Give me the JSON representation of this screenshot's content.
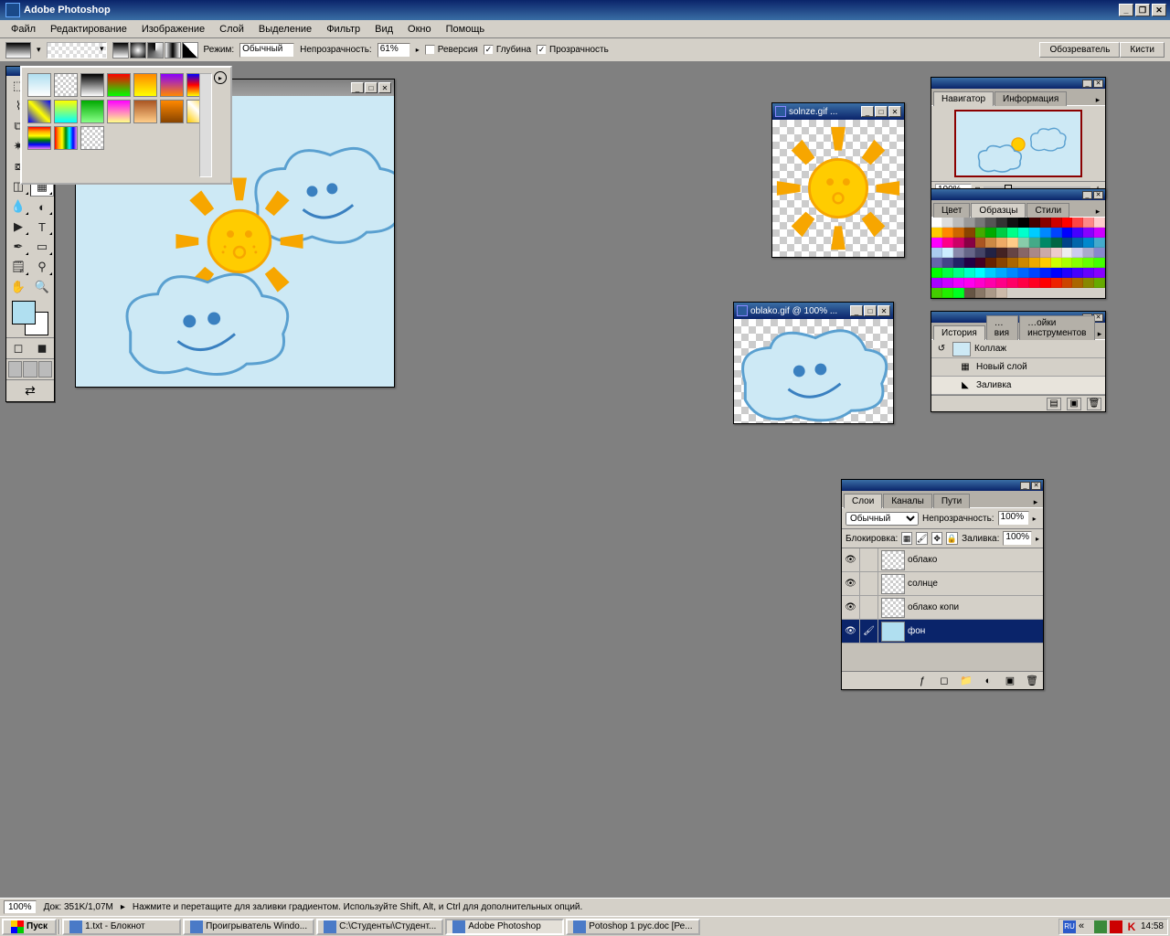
{
  "app": {
    "title": "Adobe Photoshop"
  },
  "menu": [
    "Файл",
    "Редактирование",
    "Изображение",
    "Слой",
    "Выделение",
    "Фильтр",
    "Вид",
    "Окно",
    "Помощь"
  ],
  "options": {
    "mode_label": "Режим:",
    "mode_value": "Обычный",
    "opacity_label": "Непрозрачность:",
    "opacity_value": "61%",
    "reverse_label": "Реверсия",
    "dither_label": "Глубина",
    "transparency_label": "Прозрачность",
    "well_tabs": [
      "Обозреватель",
      "Кисти"
    ]
  },
  "documents": {
    "main": {
      "title": ")"
    },
    "sun": {
      "title": "solnze.gif ..."
    },
    "cloud": {
      "title": "oblako.gif @ 100% ..."
    }
  },
  "navigator": {
    "tabs": [
      "Навигатор",
      "Информация"
    ],
    "zoom": "100%"
  },
  "color": {
    "tabs": [
      "Цвет",
      "Образцы",
      "Стили"
    ]
  },
  "history": {
    "tabs": [
      "История",
      "…вия",
      "…ойки инструментов"
    ],
    "doc_name": "Коллаж",
    "items": [
      "Новый слой",
      "Заливка"
    ]
  },
  "layers": {
    "tabs": [
      "Слои",
      "Каналы",
      "Пути"
    ],
    "blend_mode": "Обычный",
    "opacity_label": "Непрозрачность:",
    "opacity_value": "100%",
    "lock_label": "Блокировка:",
    "fill_label": "Заливка:",
    "fill_value": "100%",
    "items": [
      {
        "name": "облако",
        "active": false,
        "thumb": "checker"
      },
      {
        "name": "солнце",
        "active": false,
        "thumb": "checker"
      },
      {
        "name": "облако копи",
        "active": false,
        "thumb": "checker"
      },
      {
        "name": "фон",
        "active": true,
        "thumb": "sky"
      }
    ]
  },
  "status": {
    "zoom": "100%",
    "doc_size": "Док: 351K/1,07M",
    "hint": "Нажмите и перетащите для заливки градиентом. Используйте Shift, Alt, и Ctrl для дополнительных опций."
  },
  "taskbar": {
    "start": "Пуск",
    "items": [
      {
        "label": "1.txt - Блокнот",
        "active": false
      },
      {
        "label": "Проигрыватель Windo...",
        "active": false
      },
      {
        "label": "C:\\Студенты\\Студент...",
        "active": false
      },
      {
        "label": "Adobe Photoshop",
        "active": true
      },
      {
        "label": "Potoshop 1 рус.doc [Ре...",
        "active": false
      }
    ],
    "lang": "RU",
    "time": "14:58"
  }
}
